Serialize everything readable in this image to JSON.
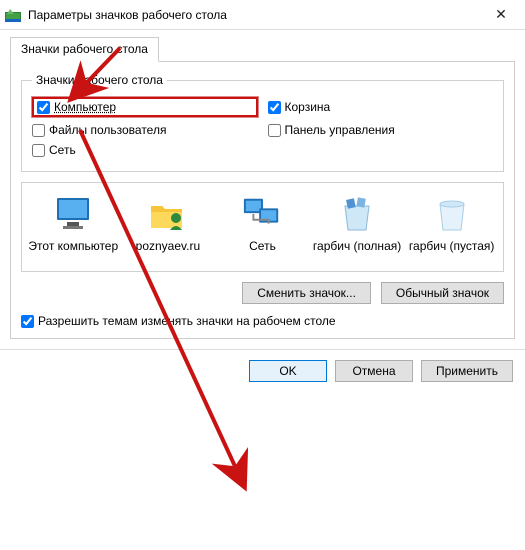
{
  "window": {
    "title": "Параметры значков рабочего стола",
    "close": "✕"
  },
  "tab_label": "Значки рабочего стола",
  "group_title": "Значки рабочего стола",
  "checks": {
    "computer": {
      "label": "Компьютер",
      "checked": true
    },
    "recyclebin": {
      "label": "Корзина",
      "checked": true
    },
    "userfiles": {
      "label": "Файлы пользователя",
      "checked": false
    },
    "controlpanel": {
      "label": "Панель управления",
      "checked": false
    },
    "network": {
      "label": "Сеть",
      "checked": false
    }
  },
  "preview_items": [
    {
      "label": "Этот компьютер"
    },
    {
      "label": "poznyaev.ru"
    },
    {
      "label": "Сеть"
    },
    {
      "label": "гарбич (полная)"
    },
    {
      "label": "гарбич (пустая)"
    }
  ],
  "buttons": {
    "change_icon": "Сменить значок...",
    "default_icon": "Обычный значок",
    "ok": "OK",
    "cancel": "Отмена",
    "apply": "Применить"
  },
  "allow_themes": {
    "label": "Разрешить темам изменять значки на рабочем столе",
    "checked": true
  }
}
